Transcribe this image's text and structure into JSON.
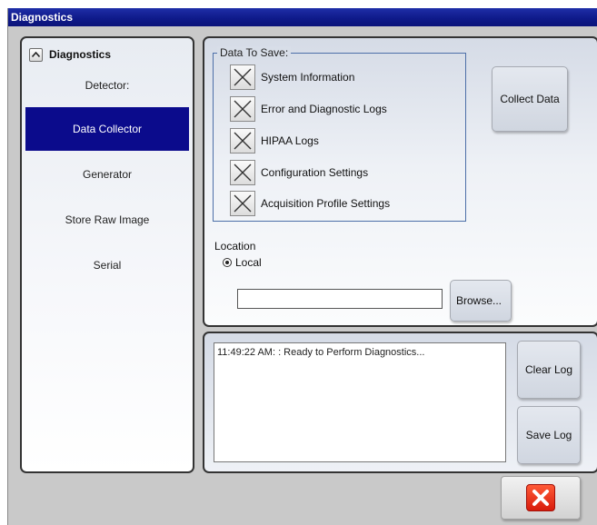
{
  "window": {
    "title": "Diagnostics"
  },
  "nav": {
    "header": "Diagnostics",
    "collapse_glyph": "^",
    "items": [
      {
        "label": "Detector:"
      },
      {
        "label": "Data Collector",
        "selected": true
      },
      {
        "label": "Generator"
      },
      {
        "label": "Store Raw Image"
      },
      {
        "label": "Serial"
      }
    ]
  },
  "data_to_save": {
    "legend": "Data To Save:",
    "options": [
      {
        "label": "System Information",
        "checked": true
      },
      {
        "label": "Error and Diagnostic Logs",
        "checked": true
      },
      {
        "label": "HIPAA Logs",
        "checked": true
      },
      {
        "label": "Configuration Settings",
        "checked": true
      },
      {
        "label": "Acquisition Profile Settings",
        "checked": true
      }
    ]
  },
  "collect_button": "Collect Data",
  "location": {
    "label": "Location",
    "radio_label": "Local",
    "path_value": "",
    "browse_button": "Browse..."
  },
  "log": {
    "text": "11:49:22 AM: : Ready to Perform Diagnostics...",
    "clear_button": "Clear Log",
    "save_button": "Save Log"
  },
  "colors": {
    "titlebar": "#0f1a8a",
    "selected_nav": "#0b0b8c",
    "close_red": "#e0301a"
  },
  "icons": {
    "checkbox": "x-mark-icon",
    "close": "close-icon"
  }
}
